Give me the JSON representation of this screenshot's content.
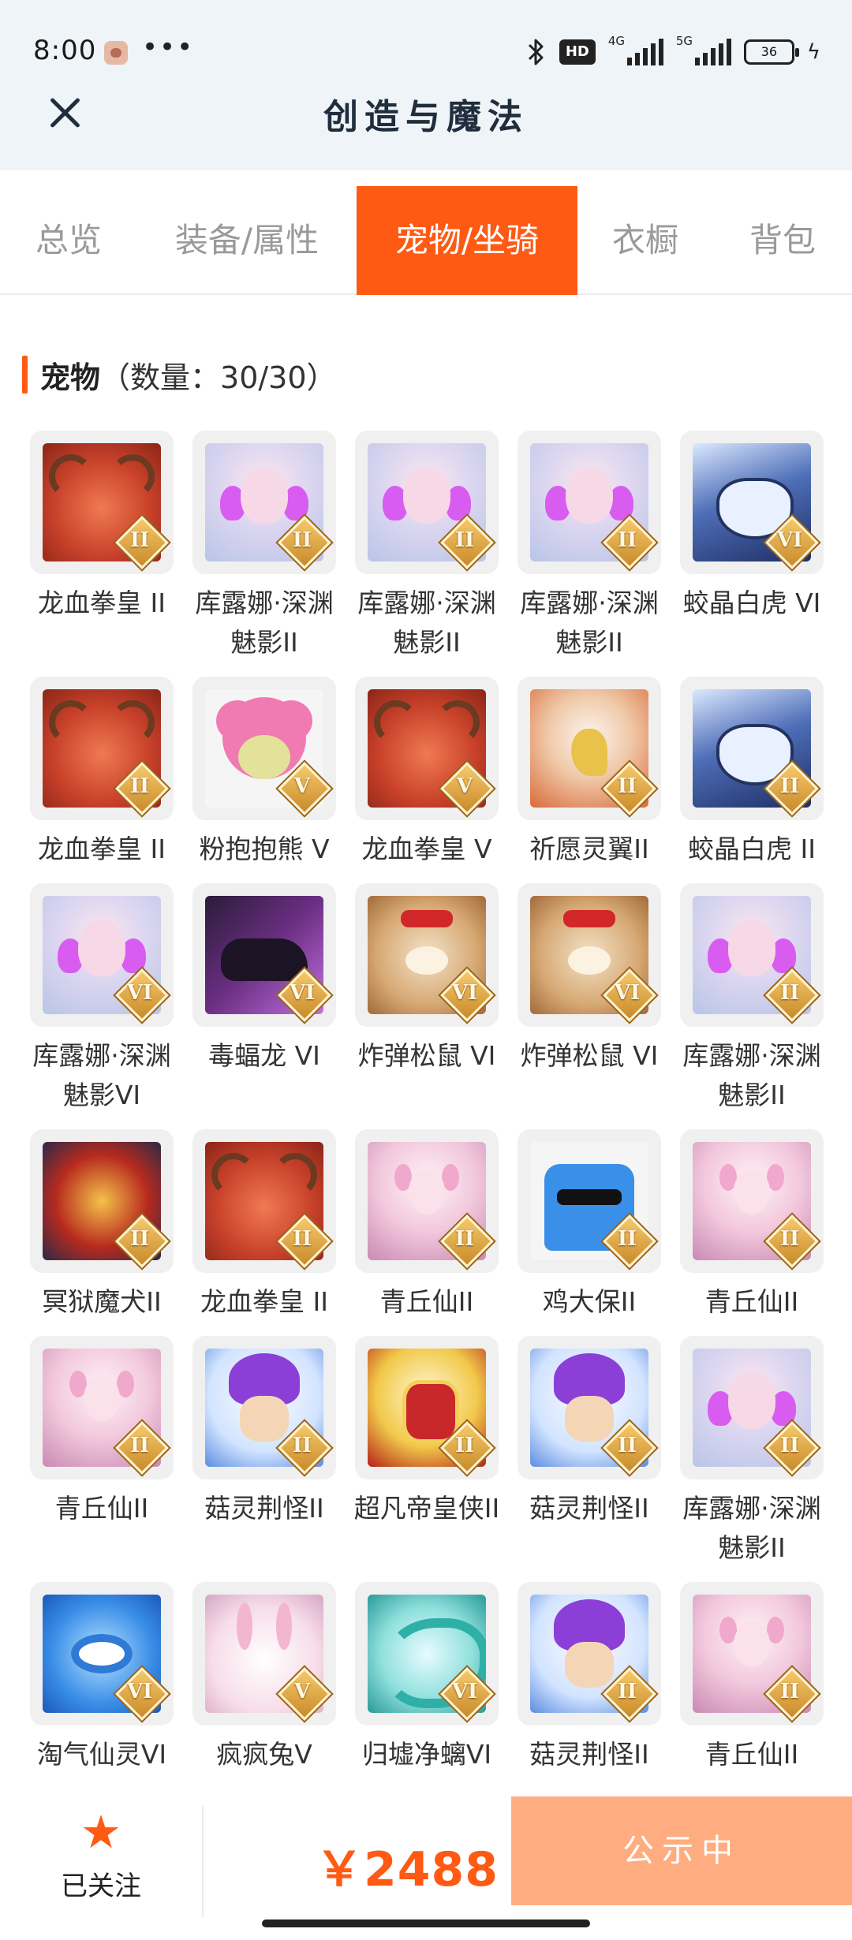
{
  "status_bar": {
    "time": "8:00",
    "more": "•••",
    "hd_label": "HD",
    "signal1_label": "4G",
    "signal2_label": "5G",
    "battery_level": "36",
    "battery_fill_percent": 36
  },
  "header": {
    "title": "创造与魔法"
  },
  "tabs": [
    {
      "label": "总览",
      "active": false
    },
    {
      "label": "装备/属性",
      "active": false
    },
    {
      "label": "宠物/坐骑",
      "active": true
    },
    {
      "label": "衣橱",
      "active": false
    },
    {
      "label": "背包",
      "active": false
    }
  ],
  "section": {
    "title": "宠物",
    "count": "（数量：30/30）"
  },
  "pets": [
    {
      "name": "龙血拳皇 II",
      "tier": "II",
      "art": "dragon"
    },
    {
      "name": "库露娜·深渊魅影II",
      "tier": "II",
      "art": "kulu"
    },
    {
      "name": "库露娜·深渊魅影II",
      "tier": "II",
      "art": "kulu"
    },
    {
      "name": "库露娜·深渊魅影II",
      "tier": "II",
      "art": "kulu"
    },
    {
      "name": "蛟晶白虎 VI",
      "tier": "VI",
      "art": "tiger"
    },
    {
      "name": "龙血拳皇 II",
      "tier": "II",
      "art": "dragon"
    },
    {
      "name": "粉抱抱熊 V",
      "tier": "V",
      "art": "bear"
    },
    {
      "name": "龙血拳皇 V",
      "tier": "V",
      "art": "dragon"
    },
    {
      "name": "祈愿灵翼II",
      "tier": "II",
      "art": "eagle"
    },
    {
      "name": "蛟晶白虎 II",
      "tier": "II",
      "art": "tiger"
    },
    {
      "name": "库露娜·深渊魅影VI",
      "tier": "VI",
      "art": "kulu"
    },
    {
      "name": "毒蝠龙 VI",
      "tier": "VI",
      "art": "beast"
    },
    {
      "name": "炸弹松鼠 VI",
      "tier": "VI",
      "art": "squirrel"
    },
    {
      "name": "炸弹松鼠 VI",
      "tier": "VI",
      "art": "squirrel"
    },
    {
      "name": "库露娜·深渊魅影II",
      "tier": "II",
      "art": "kulu"
    },
    {
      "name": "冥狱魔犬II",
      "tier": "II",
      "art": "hound"
    },
    {
      "name": "龙血拳皇 II",
      "tier": "II",
      "art": "dragon"
    },
    {
      "name": "青丘仙II",
      "tier": "II",
      "art": "fox"
    },
    {
      "name": "鸡大保II",
      "tier": "II",
      "art": "bird"
    },
    {
      "name": "青丘仙II",
      "tier": "II",
      "art": "fox"
    },
    {
      "name": "青丘仙II",
      "tier": "II",
      "art": "fox"
    },
    {
      "name": "菇灵荆怪II",
      "tier": "II",
      "art": "mushroom"
    },
    {
      "name": "超凡帝皇侠II",
      "tier": "II",
      "art": "hero"
    },
    {
      "name": "菇灵荆怪II",
      "tier": "II",
      "art": "mushroom"
    },
    {
      "name": "库露娜·深渊魅影II",
      "tier": "II",
      "art": "kulu"
    },
    {
      "name": "淘气仙灵VI",
      "tier": "VI",
      "art": "pup"
    },
    {
      "name": "疯疯兔V",
      "tier": "V",
      "art": "rabbit"
    },
    {
      "name": "归墟净螭VI",
      "tier": "VI",
      "art": "serpent"
    },
    {
      "name": "菇灵荆怪II",
      "tier": "II",
      "art": "mushroom"
    },
    {
      "name": "青丘仙II",
      "tier": "II",
      "art": "fox"
    }
  ],
  "footer": {
    "follow_label": "已关注",
    "price": "￥2488",
    "status_button": "公示中"
  },
  "colors": {
    "accent": "#ff5a14",
    "status_button_bg": "#ffad80",
    "header_bg": "#eff4f8"
  }
}
